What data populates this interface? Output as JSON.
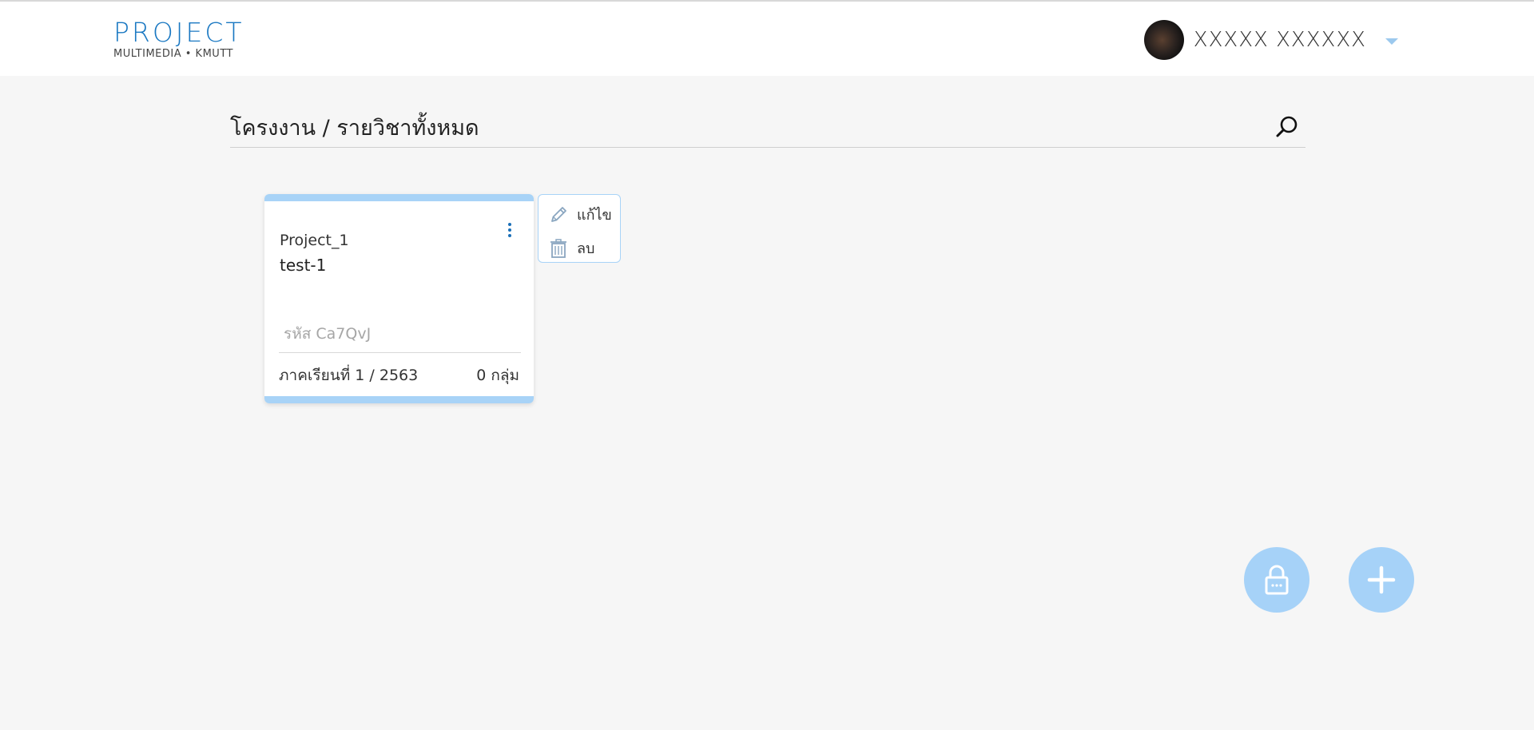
{
  "header": {
    "logo_title": "PROJECT",
    "logo_subtitle": "MULTIMEDIA • KMUTT",
    "user_name": "XXXXX XXXXXX"
  },
  "page": {
    "title": "โครงงาน / รายวิชาทั้งหมด"
  },
  "cards": [
    {
      "name": "Project_1",
      "description": "test-1",
      "code": "รหัส Ca7QvJ",
      "term": "ภาคเรียนที่ 1 / 2563",
      "groups": "0 กลุ่ม"
    }
  ],
  "card_menu": {
    "edit_label": "แก้ไข",
    "delete_label": "ลบ"
  },
  "icons": {
    "search": "search-icon",
    "kebab": "more-vertical-icon",
    "edit": "pencil-icon",
    "delete": "trash-icon",
    "lock": "lock-icon",
    "add": "plus-icon",
    "caret": "chevron-down-icon"
  },
  "colors": {
    "brand": "#1a78c2",
    "accent_light": "#a8d3f7",
    "fab": "#a6d2f8",
    "background": "#f6f6f6"
  }
}
